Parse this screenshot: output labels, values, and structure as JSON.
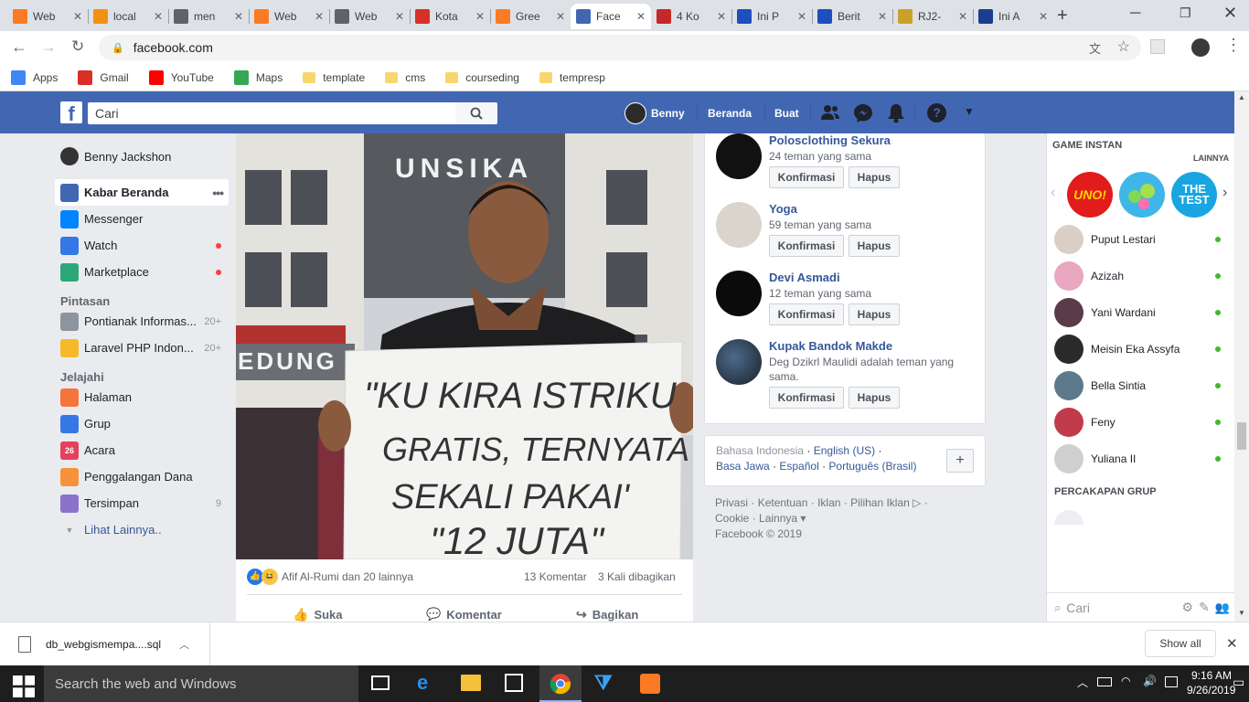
{
  "browser": {
    "tabs": [
      {
        "label": "Web",
        "icon": "xampp-icon",
        "color": "#fb7a24",
        "active": false
      },
      {
        "label": "local",
        "icon": "phpmyadmin-icon",
        "color": "#f29111",
        "active": false
      },
      {
        "label": "men",
        "icon": "globe-icon",
        "color": "#5f6368",
        "active": false
      },
      {
        "label": "Web",
        "icon": "xampp-icon",
        "color": "#fb7a24",
        "active": false
      },
      {
        "label": "Web",
        "icon": "globe-icon",
        "color": "#5f6368",
        "active": false
      },
      {
        "label": "Kota",
        "icon": "gmail-icon",
        "color": "#d93025",
        "active": false
      },
      {
        "label": "Gree",
        "icon": "xampp-icon",
        "color": "#fb7a24",
        "active": false
      },
      {
        "label": "Face",
        "icon": "facebook-icon",
        "color": "#4267b2",
        "active": true
      },
      {
        "label": "4 Ko",
        "icon": "s-icon",
        "color": "#c62828",
        "active": false
      },
      {
        "label": "Ini P",
        "icon": "d-icon",
        "color": "#1e4fc1",
        "active": false
      },
      {
        "label": "Berit",
        "icon": "d-icon",
        "color": "#1e4fc1",
        "active": false
      },
      {
        "label": "RJ2-",
        "icon": "emblem-icon",
        "color": "#c9a227",
        "active": false
      },
      {
        "label": "Ini A",
        "icon": "a-icon",
        "color": "#1a3d8f",
        "active": false
      }
    ],
    "url": "facebook.com",
    "bookmarks": [
      {
        "label": "Apps",
        "icon": "apps-grid-icon"
      },
      {
        "label": "Gmail",
        "icon": "gmail-icon"
      },
      {
        "label": "YouTube",
        "icon": "youtube-icon"
      },
      {
        "label": "Maps",
        "icon": "maps-icon"
      },
      {
        "label": "template",
        "icon": "folder-icon"
      },
      {
        "label": "cms",
        "icon": "folder-icon"
      },
      {
        "label": "courseding",
        "icon": "folder-icon"
      },
      {
        "label": "tempresp",
        "icon": "folder-icon"
      }
    ]
  },
  "fb": {
    "search_placeholder": "Cari",
    "nav_user": "Benny",
    "nav_home": "Beranda",
    "nav_create": "Buat",
    "brand_color": "#4267b2"
  },
  "left": {
    "profile": "Benny Jackshon",
    "main": [
      {
        "label": "Kabar Beranda",
        "icon": "news-feed-icon",
        "color": "#4267b2",
        "active": true
      },
      {
        "label": "Messenger",
        "icon": "messenger-icon",
        "color": "#0084ff"
      },
      {
        "label": "Watch",
        "icon": "watch-icon",
        "color": "#3578e5",
        "dot": true
      },
      {
        "label": "Marketplace",
        "icon": "marketplace-icon",
        "color": "#2aa876",
        "dot": true
      }
    ],
    "shortcuts_title": "Pintasan",
    "shortcuts": [
      {
        "label": "Pontianak Informas...",
        "count": "20+",
        "icon": "group-icon",
        "color": "#8d949e"
      },
      {
        "label": "Laravel PHP Indon...",
        "count": "20+",
        "icon": "lightbulb-icon",
        "color": "#f7b928"
      }
    ],
    "explore_title": "Jelajahi",
    "explore": [
      {
        "label": "Halaman",
        "icon": "flag-icon",
        "color": "#f5743c"
      },
      {
        "label": "Grup",
        "icon": "groups-icon",
        "color": "#3578e5"
      },
      {
        "label": "Acara",
        "icon": "calendar-icon",
        "color": "#e4405f",
        "text": "26"
      },
      {
        "label": "Penggalangan Dana",
        "icon": "heart-icon",
        "color": "#f7923b"
      },
      {
        "label": "Tersimpan",
        "icon": "bookmark-icon",
        "color": "#8c72cb",
        "count": "9"
      }
    ],
    "see_more": "Lihat Lainnya.."
  },
  "post": {
    "sign_lines": [
      "\"KU KIRA ISTRIKU",
      "GRATIS, TERNYATA",
      "SEKALI PAKAI'",
      "\"12 JUTA\""
    ],
    "building_text": "UNSIKA",
    "building_text2": "EDUNG",
    "reactions": "Afif Al-Rumi dan 20 lainnya",
    "comments": "13 Komentar",
    "shares": "3 Kali dibagikan",
    "like": "Suka",
    "comment": "Komentar",
    "share": "Bagikan"
  },
  "requests": [
    {
      "name": "Polosclothing Sekura",
      "mutual": "24 teman yang sama"
    },
    {
      "name": "Yoga",
      "mutual": "59 teman yang sama"
    },
    {
      "name": "Devi Asmadi",
      "mutual": "12 teman yang sama"
    },
    {
      "name": "Kupak Bandok Makde",
      "mutual": "Deg Dzikrl Maulidi adalah teman yang sama."
    }
  ],
  "request_buttons": {
    "confirm": "Konfirmasi",
    "delete": "Hapus"
  },
  "languages": {
    "current": "Bahasa Indonesia",
    "options": [
      "English (US)",
      "Basa Jawa",
      "Español",
      "Português (Brasil)"
    ],
    "add": "+"
  },
  "footer_links": [
    "Privasi",
    "Ketentuan",
    "Iklan",
    "Pilihan Iklan",
    "Cookie",
    "Lainnya"
  ],
  "copyright": "Facebook © 2019",
  "games": {
    "title": "GAME INSTAN",
    "more": "LAINNYA",
    "items": [
      {
        "label": "UNO!",
        "color": "#e21b1b"
      },
      {
        "label": "",
        "color": "#3fb6e8"
      },
      {
        "label": "THE TEST",
        "color": "#19a6e0"
      }
    ]
  },
  "contacts": [
    {
      "name": "Puput Lestari"
    },
    {
      "name": "Azizah"
    },
    {
      "name": "Yani Wardani"
    },
    {
      "name": "Meisin Eka Assyfa"
    },
    {
      "name": "Bella Sintia"
    },
    {
      "name": "Feny"
    },
    {
      "name": "Yuliana II"
    }
  ],
  "group_chat_title": "PERCAKAPAN GRUP",
  "chat_search": "Cari",
  "download": {
    "file": "db_webgismempa....sql",
    "show_all": "Show all"
  },
  "taskbar": {
    "search": "Search the web and Windows",
    "time": "9:16 AM",
    "date": "9/26/2019"
  }
}
